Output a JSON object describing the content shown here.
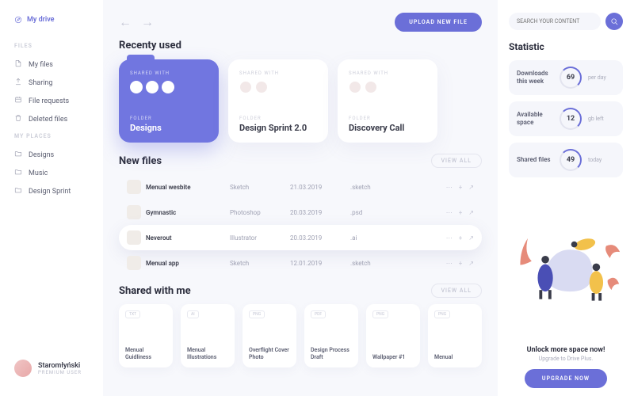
{
  "sidebar": {
    "active": "My drive",
    "sections": [
      {
        "header": "FILES",
        "items": [
          "My files",
          "Sharing",
          "File requests",
          "Deleted files"
        ]
      },
      {
        "header": "MY PLACES",
        "items": [
          "Designs",
          "Music",
          "Design Sprint"
        ]
      }
    ],
    "user": {
      "name": "Staromłyński",
      "role": "PREMIUM USER"
    }
  },
  "main": {
    "upload_label": "UPLOAD NEW FILE",
    "recent_heading": "Recenty used",
    "shared_with_label": "SHARED WITH",
    "folder_type_label": "FOLDER",
    "folders": [
      {
        "name": "Designs",
        "variant": "purple",
        "avatars": 3
      },
      {
        "name": "Design Sprint 2.0",
        "variant": "white",
        "avatars": 2
      },
      {
        "name": "Discovery Call",
        "variant": "white",
        "avatars": 2
      }
    ],
    "newfiles_heading": "New files",
    "viewall_label": "VIEW ALL",
    "files": [
      {
        "name": "Menual wesbite",
        "app": "Sketch",
        "date": "21.03.2019",
        "ext": ".sketch",
        "selected": false
      },
      {
        "name": "Gymnastic",
        "app": "Photoshop",
        "date": "20.03.2019",
        "ext": ".psd",
        "selected": false
      },
      {
        "name": "Neverout",
        "app": "Illustrator",
        "date": "20.03.2019",
        "ext": ".ai",
        "selected": true
      },
      {
        "name": "Menual app",
        "app": "Sketch",
        "date": "12.01.2019",
        "ext": ".sketch",
        "selected": false
      }
    ],
    "sharedwithme_heading": "Shared with me",
    "shared": [
      {
        "tag": "TXT",
        "name": "Menual Guidliness"
      },
      {
        "tag": "AI",
        "name": "Menual Illustrations"
      },
      {
        "tag": "PNG",
        "name": "Overflight Cover Photo"
      },
      {
        "tag": "PDF",
        "name": "Design Process Draft"
      },
      {
        "tag": "PNG",
        "name": "Wallpaper #1"
      },
      {
        "tag": "PNG",
        "name": "Menual"
      }
    ]
  },
  "right": {
    "search_placeholder": "SEARCH YOUR CONTENT",
    "stat_heading": "Statistic",
    "stats": [
      {
        "label": "Downloads this week",
        "value": "69",
        "unit": "per day"
      },
      {
        "label": "Available space",
        "value": "12",
        "unit": "gb left"
      },
      {
        "label": "Shared files",
        "value": "49",
        "unit": "today"
      }
    ],
    "promo": {
      "title": "Unlock more space now!",
      "subtitle": "Upgrade to Drive Plus.",
      "button": "UPGRADE NOW"
    }
  }
}
